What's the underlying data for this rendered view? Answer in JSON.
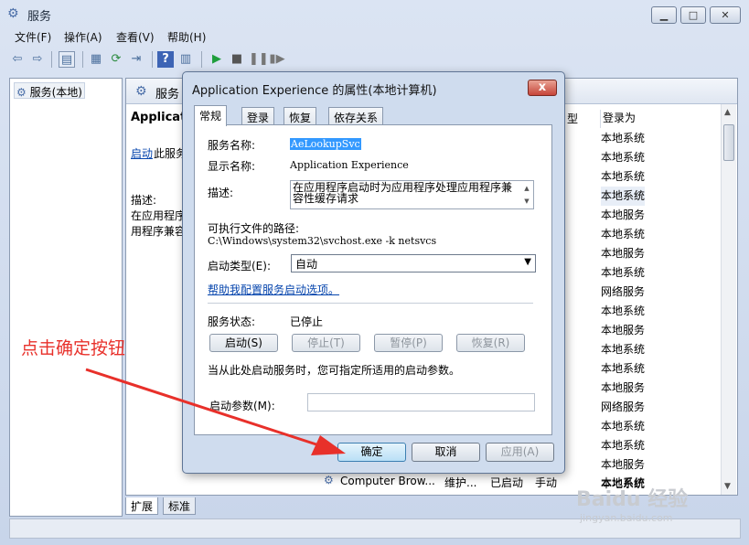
{
  "main": {
    "title": "服务",
    "menu": [
      "文件(F)",
      "操作(A)",
      "查看(V)",
      "帮助(H)"
    ],
    "tree_item": "服务(本地)",
    "header_title": "服务",
    "app_heading": "Applicati",
    "start_link": "启动",
    "start_rest": "此服务",
    "desc_label": "描述:",
    "desc_line1": "在应用程序",
    "desc_line2": "用程序兼容",
    "col_type": "型",
    "col_logon": "登录为",
    "logon_values": [
      "本地系统",
      "本地系统",
      "本地系统",
      "本地系统",
      "本地服务",
      "本地系统",
      "本地服务",
      "本地系统",
      "网络服务",
      "本地系统",
      "本地服务",
      "本地系统",
      "本地系统",
      "本地服务",
      "网络服务",
      "本地系统",
      "本地系统",
      "本地服务",
      "本地系统"
    ],
    "bottom_row": {
      "name": "Computer Brow...",
      "desc": "维护...",
      "status": "已启动",
      "startup": "手动",
      "logon": "本地系统"
    },
    "bottom_tabs": [
      "扩展",
      "标准"
    ]
  },
  "dialog": {
    "title": "Application Experience 的属性(本地计算机)",
    "close": "x",
    "tabs": [
      "常规",
      "登录",
      "恢复",
      "依存关系"
    ],
    "svc_name_label": "服务名称:",
    "svc_name_value": "AeLookupSvc",
    "display_name_label": "显示名称:",
    "display_name_value": "Application Experience",
    "desc_label": "描述:",
    "desc_value": "在应用程序启动时为应用程序处理应用程序兼容性缓存请求",
    "path_label": "可执行文件的路径:",
    "path_value": "C:\\Windows\\system32\\svchost.exe -k netsvcs",
    "start_type_label": "启动类型(E):",
    "start_type_value": "自动",
    "help_link": "帮助我配置服务启动选项。",
    "status_label": "服务状态:",
    "status_value": "已停止",
    "btn_start": "启动(S)",
    "btn_stop": "停止(T)",
    "btn_pause": "暂停(P)",
    "btn_resume": "恢复(R)",
    "hint": "当从此处启动服务时，您可指定所适用的启动参数。",
    "param_label": "启动参数(M):",
    "param_value": "",
    "ok": "确定",
    "cancel": "取消",
    "apply": "应用(A)"
  },
  "annotation": {
    "text": "点击确定按钮",
    "color": "#e8302a"
  },
  "watermark": {
    "text": "Baidu 经验",
    "sub": "jingyan.baidu.com"
  }
}
